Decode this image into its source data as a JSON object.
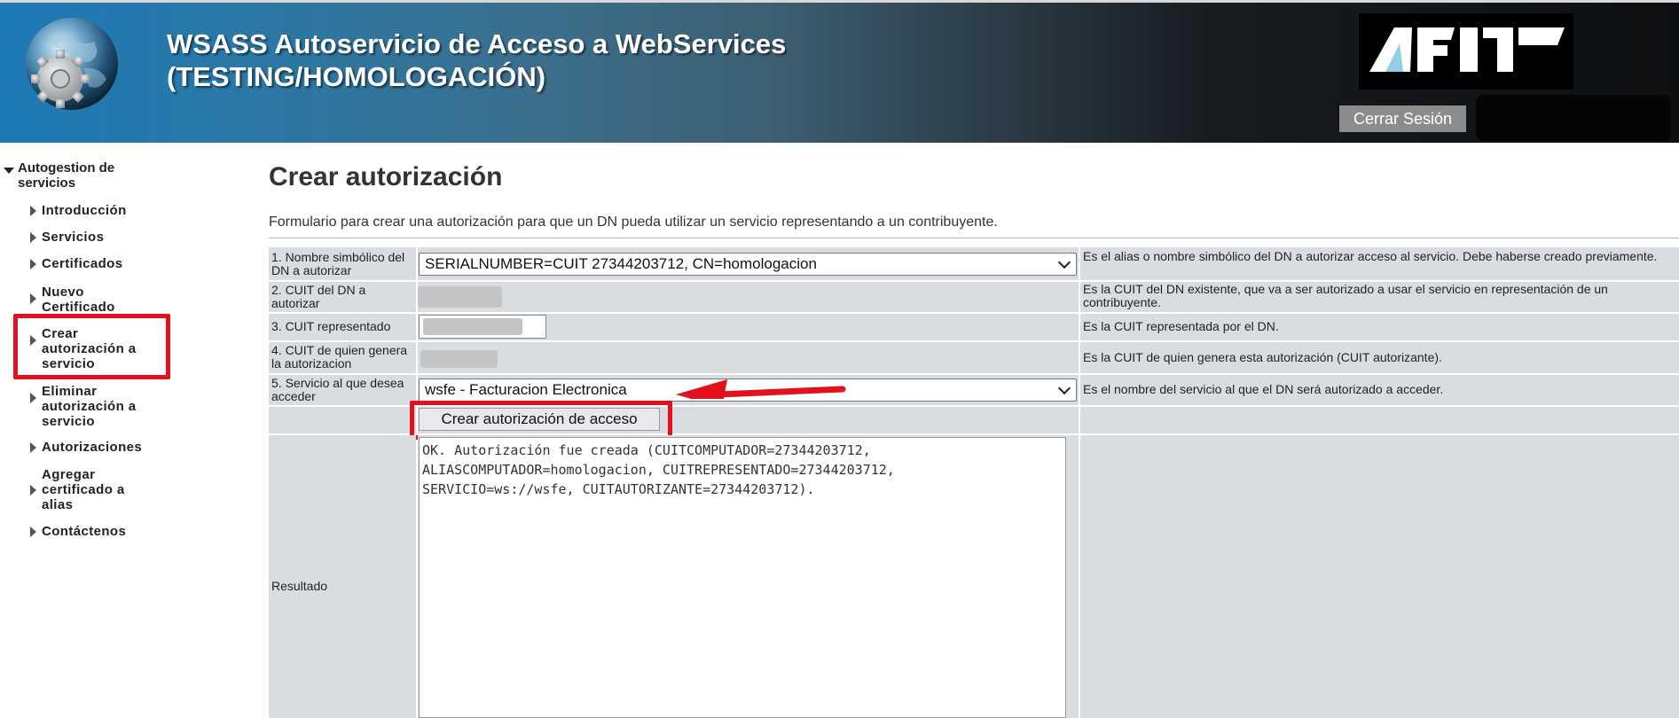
{
  "header": {
    "title_line1": "WSASS Autoservicio de Acceso a WebServices",
    "title_line2": "(TESTING/HOMOLOGACIÓN)",
    "logout_label": "Cerrar Sesión",
    "logo_name": "afip-logo",
    "globe_icon": "globe-gear-icon"
  },
  "sidebar": {
    "root_label": "Autogestion de servicios",
    "items": [
      {
        "label": "Introducción"
      },
      {
        "label": "Servicios"
      },
      {
        "label": "Certificados"
      },
      {
        "label": "Nuevo Certificado"
      },
      {
        "label": "Crear autorización a servicio"
      },
      {
        "label": "Eliminar autorización a servicio"
      },
      {
        "label": "Autorizaciones"
      },
      {
        "label": "Agregar certificado a alias"
      },
      {
        "label": "Contáctenos"
      }
    ]
  },
  "main": {
    "title": "Crear autorización",
    "description": "Formulario para crear una autorización para que un DN pueda utilizar un servicio representando a un contribuyente.",
    "form": {
      "row1": {
        "label": "1. Nombre simbólico del DN a autorizar",
        "value": "SERIALNUMBER=CUIT 27344203712, CN=homologacion",
        "hint": "Es el alias o nombre simbólico del DN a autorizar acceso al servicio. Debe haberse creado previamente."
      },
      "row2": {
        "label": "2. CUIT del DN a autorizar",
        "hint": "Es la CUIT del DN existente, que va a ser autorizado a usar el servicio en representación de un contribuyente."
      },
      "row3": {
        "label": "3. CUIT representado",
        "hint": "Es la CUIT representada por el DN."
      },
      "row4": {
        "label": "4. CUIT de quien genera la autorizacion",
        "hint": "Es la CUIT de quien genera esta autorización (CUIT autorizante)."
      },
      "row5": {
        "label": "5. Servicio al que desea acceder",
        "value": "wsfe - Facturacion Electronica",
        "hint": "Es el nombre del servicio al que el DN será autorizado a acceder."
      },
      "submit_label": "Crear autorización de acceso",
      "result_label": "Resultado",
      "result_text": "OK. Autorización fue creada (CUITCOMPUTADOR=27344203712,\nALIASCOMPUTADOR=homologacion, CUITREPRESENTADO=27344203712,\nSERVICIO=ws://wsfe, CUITAUTORIZANTE=27344203712)."
    }
  },
  "colors": {
    "highlight": "#e3101e",
    "form_cell": "#d9dde1"
  }
}
